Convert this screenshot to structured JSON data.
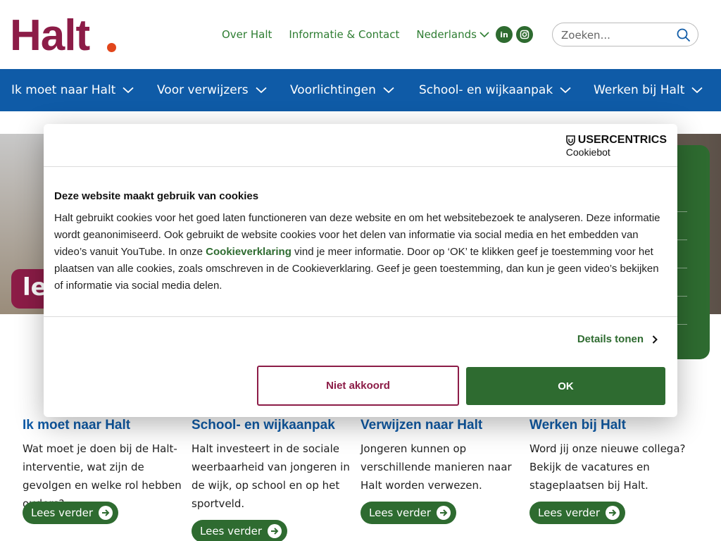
{
  "header": {
    "logo_text": "Halt",
    "links": [
      "Over Halt",
      "Informatie & Contact"
    ],
    "language": "Nederlands",
    "social": [
      {
        "icon": "linkedin-icon",
        "label": "in"
      },
      {
        "icon": "instagram-icon",
        "label": ""
      }
    ],
    "search": {
      "placeholder": "Zoeken..."
    }
  },
  "nav": {
    "items": [
      "Ik moet naar Halt",
      "Voor verwijzers",
      "Voorlichtingen",
      "School- en wijkaanpak",
      "Werken bij Halt"
    ]
  },
  "hero": {
    "tag_text": "le"
  },
  "cards": [
    {
      "title": "Ik moet naar Halt",
      "text": "Wat moet je doen bij de Halt-interventie, wat zijn de gevolgen en welke rol hebben ouders?",
      "button": "Lees verder"
    },
    {
      "title": "School- en wijkaanpak",
      "text": "Halt investeert in de sociale weerbaarheid van jongeren in de wijk, op school en op het sportveld.",
      "button": "Lees verder"
    },
    {
      "title": "Verwijzen naar Halt",
      "text": "Jongeren kunnen op verschillende manieren naar Halt worden verwezen.",
      "button": "Lees verder"
    },
    {
      "title": "Werken bij Halt",
      "text": "Word jij onze nieuwe collega? Bekijk de vacatures en stageplaatsen bij Halt.",
      "button": "Lees verder"
    }
  ],
  "cookie_dialog": {
    "brand": "USERCENTRICS",
    "brand_sub": "Cookiebot",
    "title": "Deze website maakt gebruik van cookies",
    "body_before": "Halt gebruikt cookies voor het goed laten functioneren van deze website en om het websitebezoek te analyseren. Deze informatie wordt geanonimiseerd. Ook gebruikt de website cookies voor het delen van informatie via social media en het embedden van video’s vanuit YouTube. In onze ",
    "body_link": "Cookieverklaring",
    "body_after": " vind je meer informatie. Door op ‘OK’ te klikken geef je toestemming voor het plaatsen van alle cookies, zoals omschreven in de Cookieverklaring. Geef je geen toestemming, dan kun je geen video’s bekijken of informatie via social media delen.",
    "details_label": "Details tonen",
    "reject_label": "Niet akkoord",
    "accept_label": "OK"
  },
  "colors": {
    "brand_burgundy": "#8c1c47",
    "brand_orange": "#e1461b",
    "nav_blue": "#0f5ba7",
    "accent_green": "#2e6b30"
  }
}
